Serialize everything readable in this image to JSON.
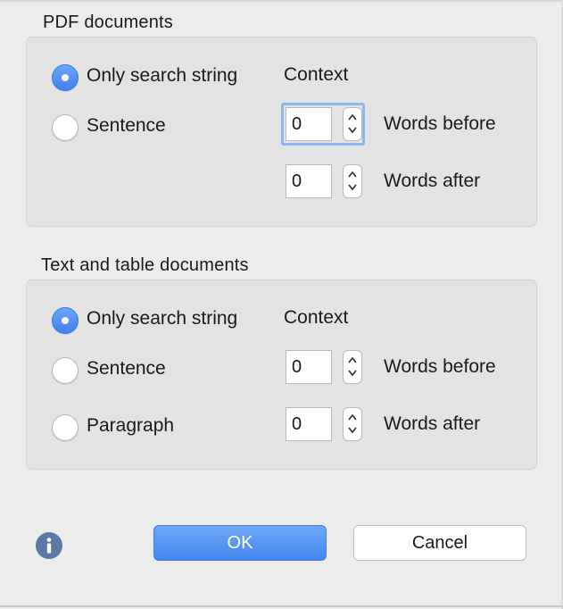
{
  "pdf": {
    "title": "PDF documents",
    "options": {
      "only_search_string": "Only search string",
      "sentence": "Sentence"
    },
    "selected": "only_search_string",
    "context_label": "Context",
    "words_before": {
      "value": "0",
      "label": "Words before"
    },
    "words_after": {
      "value": "0",
      "label": "Words after"
    }
  },
  "text_table": {
    "title": "Text and table documents",
    "options": {
      "only_search_string": "Only search string",
      "sentence": "Sentence",
      "paragraph": "Paragraph"
    },
    "selected": "only_search_string",
    "context_label": "Context",
    "words_before": {
      "value": "0",
      "label": "Words before"
    },
    "words_after": {
      "value": "0",
      "label": "Words after"
    }
  },
  "buttons": {
    "ok": "OK",
    "cancel": "Cancel"
  },
  "colors": {
    "accent": "#4a8bf0",
    "info_icon": "#5a7aa5"
  },
  "icons": {
    "info": "info-icon",
    "stepper": "stepper-arrows-icon"
  }
}
